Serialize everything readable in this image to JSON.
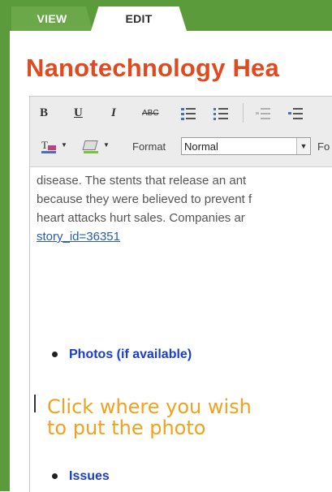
{
  "tabs": [
    {
      "label": "VIEW"
    },
    {
      "label": "EDIT"
    }
  ],
  "page_title": "Nanotechnology Hea",
  "toolbar": {
    "bold": "B",
    "underline": "U",
    "italic": "I",
    "strike": "ABC",
    "format_label": "Format",
    "format_value": "Normal",
    "font_label_partial": "Fo",
    "icons": [
      "bold-icon",
      "underline-icon",
      "italic-icon",
      "strikethrough-icon",
      "numbered-list-icon",
      "bulleted-list-icon",
      "outdent-icon",
      "indent-icon",
      "text-color-icon",
      "background-color-icon",
      "dropdown-arrow-icon"
    ]
  },
  "content": {
    "lines": [
      "disease. The stents that release an ant",
      "because they were believed to prevent f",
      "heart attacks hurt sales. Companies ar"
    ],
    "link": "story_id=36351",
    "bullets": [
      "Photos (if available)",
      "Issues"
    ]
  },
  "hint": {
    "line1": "Click where you wish",
    "line2": "to put the photo"
  },
  "colors": {
    "frame_green": "#5b9b3c",
    "title_orange": "#e04a1f",
    "bullet_blue": "#1a3ec8",
    "hint_orange": "#f0a21e"
  }
}
